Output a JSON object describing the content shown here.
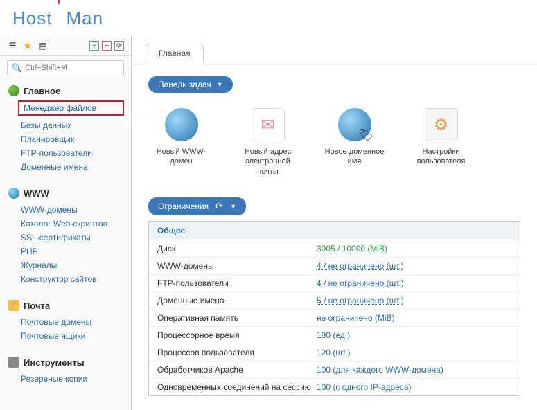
{
  "logo": {
    "left": "Host",
    "right": "Man"
  },
  "search": {
    "placeholder": "Ctrl+Shift+M"
  },
  "tab": {
    "main": "Главная"
  },
  "task_panel_label": "Панель задач",
  "limits_label": "Ограничения",
  "limits_sub": "Общее",
  "sidebar": {
    "sections": [
      {
        "title": "Главное",
        "items": [
          "Менеджер файлов",
          "Базы данных",
          "Планировщик",
          "FTP-пользователи",
          "Доменные имена"
        ]
      },
      {
        "title": "WWW",
        "items": [
          "WWW-домены",
          "Каталог Web-скриптов",
          "SSL-сертификаты",
          "PHP",
          "Журналы",
          "Конструктор сайтов"
        ]
      },
      {
        "title": "Почта",
        "items": [
          "Почтовые домены",
          "Почтовые ящики"
        ]
      },
      {
        "title": "Инструменты",
        "items": [
          "Резервные копии"
        ]
      }
    ]
  },
  "tasks": [
    {
      "label": "Новый WWW-домен"
    },
    {
      "label": "Новый адрес электронной почты"
    },
    {
      "label": "Новое доменное имя"
    },
    {
      "label": "Настройки пользователя"
    }
  ],
  "limits": [
    {
      "label": "Диск",
      "value": "3005 / 10000 (MiB)",
      "green": true
    },
    {
      "label": "WWW-домены",
      "value": "4 / не ограничено (шт.)",
      "ul": true
    },
    {
      "label": "FTP-пользователи",
      "value": "4 / не ограничено (шт.)",
      "ul": true
    },
    {
      "label": "Доменные имена",
      "value": "5 / не ограничено (шт.)",
      "ul": true
    },
    {
      "label": "Оперативная память",
      "value": "не ограничено (MiB)"
    },
    {
      "label": "Процессорное время",
      "value": "180 (ед.)"
    },
    {
      "label": "Процессов пользователя",
      "value": "120 (шт.)"
    },
    {
      "label": "Обработчиков Apache",
      "value": "100 (для каждого WWW-домена)"
    },
    {
      "label": "Одновременных соединений на сессию",
      "value": "100 (с одного IP-адреса)"
    }
  ]
}
